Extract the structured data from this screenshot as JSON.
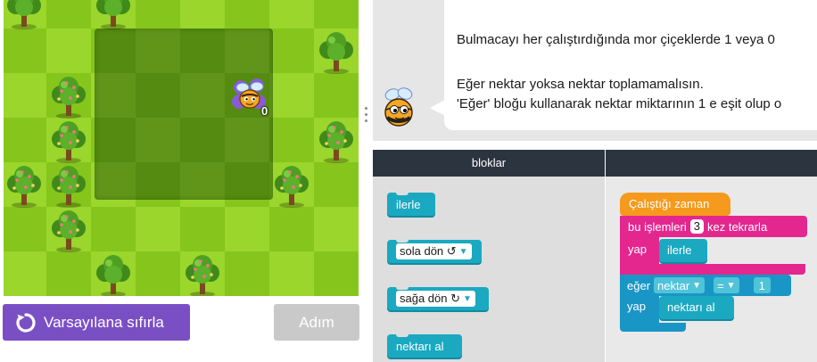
{
  "game": {
    "bee_nectar_count": "0",
    "trees": [
      {
        "col": 0,
        "row": 0,
        "flowers": false
      },
      {
        "col": 2,
        "row": 0,
        "flowers": false
      },
      {
        "col": 7,
        "row": 1,
        "flowers": false
      },
      {
        "col": 1,
        "row": 2,
        "flowers": true
      },
      {
        "col": 1,
        "row": 3,
        "flowers": true
      },
      {
        "col": 7,
        "row": 3,
        "flowers": true
      },
      {
        "col": 0,
        "row": 4,
        "flowers": true
      },
      {
        "col": 1,
        "row": 4,
        "flowers": true
      },
      {
        "col": 6,
        "row": 4,
        "flowers": true
      },
      {
        "col": 1,
        "row": 5,
        "flowers": true
      },
      {
        "col": 2,
        "row": 6,
        "flowers": false
      },
      {
        "col": 4,
        "row": 6,
        "flowers": true
      }
    ]
  },
  "controls": {
    "reset_label": "Varsayılana sıfırla",
    "step_label": "Adım"
  },
  "instructions": {
    "line1": "Bulmacayı her çalıştırdığında mor çiçeklerde 1 veya 0",
    "line2": "Eğer nektar yoksa nektar toplamamalısın.",
    "line3": "'Eğer' bloğu kullanarak nektar miktarının 1 e eşit olup o"
  },
  "toolbox": {
    "header": "bloklar",
    "move_forward": "ilerle",
    "turn_left": "sola dön ↺",
    "turn_right": "sağa dön ↻",
    "collect_nectar": "nektarı al"
  },
  "workspace": {
    "when_run": "Çalıştığı zaman",
    "repeat_prefix": "bu işlemleri",
    "repeat_count": "3",
    "repeat_suffix": "kez tekrarla",
    "do_label": "yap",
    "move_forward": "ilerle",
    "if_label": "eğer",
    "if_subject": "nektar",
    "if_operator": "=",
    "if_value": "1",
    "if_do_label": "yap",
    "collect_nectar": "nektarı al"
  },
  "colors": {
    "reset_button": "#7b4fc4",
    "step_button_disabled": "#c9c9c9",
    "toolbox_header": "#2c3440",
    "action_block": "#1aa9c1",
    "event_block": "#f59a1c",
    "loop_block": "#e4278f",
    "logic_block": "#1996c6",
    "grass_light": "#9ad62b",
    "grass_dark": "#86c51c"
  },
  "icons": {
    "reset": "refresh-icon",
    "bee": "bee-icon",
    "tree": "tree-icon",
    "dropdown": "triangle-down-icon"
  }
}
